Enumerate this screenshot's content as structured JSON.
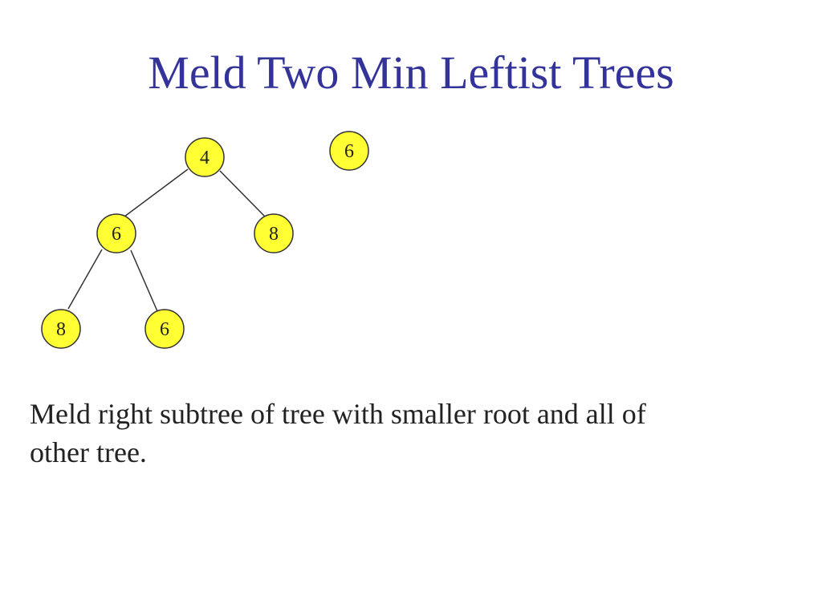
{
  "slide": {
    "title": "Meld Two Min Leftist Trees",
    "caption_line1": "Meld right subtree of tree with smaller root and all of",
    "caption_line2": "other tree."
  },
  "colors": {
    "title": "#333399",
    "node_fill": "#ffff33",
    "node_stroke": "#333333",
    "edge": "#333333",
    "text": "#222222"
  },
  "trees": {
    "tree_a": {
      "root": "4",
      "root_left": "6",
      "root_right": "8",
      "left_left": "8",
      "left_right": "6"
    },
    "tree_b": {
      "root": "6"
    }
  }
}
